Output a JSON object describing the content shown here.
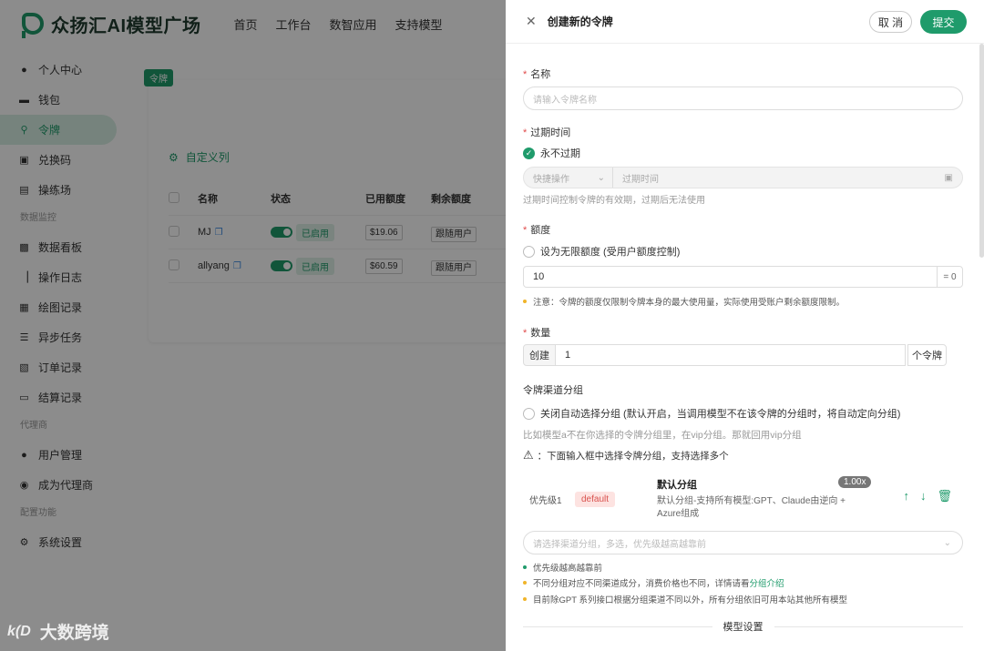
{
  "app": {
    "logo_text": "众扬汇AI模型广场",
    "top_nav": [
      "首页",
      "工作台",
      "数智应用",
      "支持模型"
    ]
  },
  "sidebar": {
    "items": [
      {
        "label": "个人中心",
        "icon": "user-icon"
      },
      {
        "label": "钱包",
        "icon": "wallet-icon"
      },
      {
        "label": "令牌",
        "icon": "key-icon",
        "active": true
      },
      {
        "label": "兑换码",
        "icon": "gift-icon"
      },
      {
        "label": "操练场",
        "icon": "playground-icon"
      }
    ],
    "group1": "数据监控",
    "items2": [
      {
        "label": "数据看板",
        "icon": "dashboard-icon"
      },
      {
        "label": "操作日志",
        "icon": "chart-icon"
      },
      {
        "label": "绘图记录",
        "icon": "image-icon"
      },
      {
        "label": "异步任务",
        "icon": "list-icon"
      },
      {
        "label": "订单记录",
        "icon": "order-icon"
      },
      {
        "label": "结算记录",
        "icon": "monitor-icon"
      }
    ],
    "group2": "代理商",
    "items3": [
      {
        "label": "用户管理",
        "icon": "user-icon"
      },
      {
        "label": "成为代理商",
        "icon": "users-icon"
      }
    ],
    "group3": "配置功能",
    "items4": [
      {
        "label": "系统设置",
        "icon": "gear-icon"
      }
    ]
  },
  "background_page": {
    "tag": "令牌",
    "custom_columns": "自定义列",
    "table": {
      "headers": [
        "名称",
        "状态",
        "已用额度",
        "剩余额度"
      ],
      "rows": [
        {
          "name": "MJ",
          "status": "已启用",
          "used": "$19.06",
          "rest": "跟随用户"
        },
        {
          "name": "allyang",
          "status": "已启用",
          "used": "$60.59",
          "rest": "跟随用户"
        }
      ]
    }
  },
  "watermark": {
    "logo": "k(D",
    "text": "大数跨境"
  },
  "drawer": {
    "title": "创建新的令牌",
    "cancel": "取 消",
    "submit": "提交",
    "name_label": "名称",
    "name_placeholder": "请输入令牌名称",
    "expire_label": "过期时间",
    "never_expire": "永不过期",
    "quick_op": "快捷操作",
    "expire_placeholder": "过期时间",
    "expire_hint": "过期时间控制令牌的有效期，过期后无法使用",
    "quota_label": "额度",
    "unlimited_quota": "设为无限额度 (受用户额度控制)",
    "quota_value": "10",
    "quota_equiv": "= 0",
    "quota_note": "注意：令牌的额度仅限制令牌本身的最大使用量，实际使用受账户剩余额度限制。",
    "count_label": "数量",
    "count_prefix": "创建",
    "count_value": "1",
    "count_suffix": "个令牌",
    "channel_group_label": "令牌渠道分组",
    "auto_group_off": "关闭自动选择分组 (默认开启，当调用模型不在该令牌的分组时，将自动定向分组)",
    "group_example": "比如模型a不在你选择的令牌分组里，在vip分组。那就回用vip分组",
    "select_tip": "：下面输入框中选择令牌分组，支持选择多个",
    "group_item": {
      "priority": "优先级1",
      "tag": "default",
      "name": "默认分组",
      "desc": "默认分组-支持所有模型:GPT、Claude由逆向 + Azure组成",
      "ratio": "1.00x"
    },
    "group_select_placeholder": "请选择渠道分组，多选，优先级越高越靠前",
    "tips": [
      {
        "text": "优先级越高越靠前",
        "color": "green"
      },
      {
        "text": "不同分组对应不同渠道成分，消费价格也不同，详情请看",
        "link": "分组介绍",
        "color": "yellow"
      },
      {
        "text": "目前除GPT 系列接口根据分组渠道不同以外，所有分组依旧可用本站其他所有模型",
        "color": "yellow"
      }
    ],
    "model_settings": "模型设置"
  },
  "colors": {
    "accent": "#1f9b6b",
    "required": "#e04a4a",
    "tag_red": "#d9534f"
  }
}
